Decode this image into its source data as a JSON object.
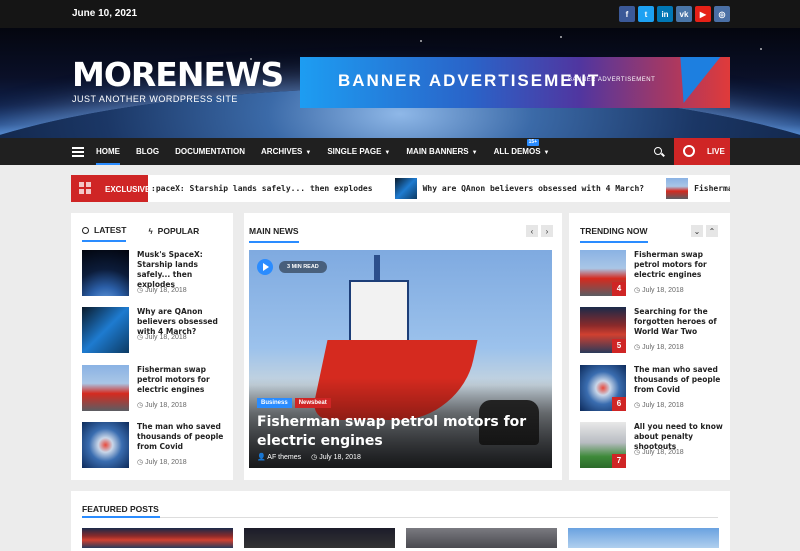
{
  "topbar": {
    "date": "June 10, 2021",
    "socials": [
      {
        "name": "facebook-icon",
        "glyph": "f",
        "color": "#3b5998"
      },
      {
        "name": "twitter-icon",
        "glyph": "t",
        "color": "#1da1f2"
      },
      {
        "name": "linkedin-icon",
        "glyph": "in",
        "color": "#0077b5"
      },
      {
        "name": "vk-icon",
        "glyph": "vk",
        "color": "#4a76a8"
      },
      {
        "name": "youtube-icon",
        "glyph": "▶",
        "color": "#e62117"
      },
      {
        "name": "instagram-icon",
        "glyph": "◎",
        "color": "#4a6fa5"
      }
    ]
  },
  "header": {
    "site_title": "MORENEWS",
    "tagline": "JUST ANOTHER WORDPRESS SITE",
    "banner_text": "BANNER ADVERTISEMENT",
    "banner_small": "BANNER ADVERTISEMENT"
  },
  "nav": {
    "items": [
      {
        "label": "HOME",
        "active": true,
        "dropdown": false
      },
      {
        "label": "BLOG",
        "active": false,
        "dropdown": false
      },
      {
        "label": "DOCUMENTATION",
        "active": false,
        "dropdown": false
      },
      {
        "label": "ARCHIVES",
        "active": false,
        "dropdown": true
      },
      {
        "label": "SINGLE PAGE",
        "active": false,
        "dropdown": true
      },
      {
        "label": "MAIN BANNERS",
        "active": false,
        "dropdown": true
      },
      {
        "label": "ALL DEMOS",
        "active": false,
        "dropdown": true,
        "badge": "15+"
      }
    ],
    "live_label": "LIVE",
    "accent": "#2a8cff",
    "live_color": "#cf2525"
  },
  "ticker": {
    "label": "EXCLUSIVE",
    "items": [
      {
        "text": ":paceX: Starship lands safely... then explodes",
        "thumb": ""
      },
      {
        "text": "Why are QAnon believers obsessed with 4 March?",
        "thumb": "th-phone"
      },
      {
        "text": "Fisherman swap petrol motors for electric engines",
        "thumb": "th-ship"
      }
    ]
  },
  "left_panel": {
    "tab_latest": "LATEST",
    "tab_popular": "POPULAR",
    "items": [
      {
        "title": "Musk's SpaceX: Starship lands safely... then explodes",
        "date": "July 18, 2018",
        "thumb": "th-space"
      },
      {
        "title": "Why are QAnon believers obsessed with 4 March?",
        "date": "July 18, 2018",
        "thumb": "th-phone"
      },
      {
        "title": "Fisherman swap petrol motors for electric engines",
        "date": "July 18, 2018",
        "thumb": "th-ship"
      },
      {
        "title": "The man who saved thousands of people from Covid",
        "date": "July 18, 2018",
        "thumb": "th-virus"
      }
    ]
  },
  "main_news": {
    "section_title": "MAIN NEWS",
    "read_time": "3 MIN READ",
    "categories": [
      {
        "label": "Business",
        "color": "#2a8cff"
      },
      {
        "label": "Newsbeat",
        "color": "#cf2525"
      }
    ],
    "title": "Fisherman swap petrol motors for electric engines",
    "author": "AF themes",
    "date": "July 18, 2018"
  },
  "trending": {
    "section_title": "TRENDING NOW",
    "items": [
      {
        "num": "4",
        "title": "Fisherman swap petrol motors for electric engines",
        "date": "July 18, 2018",
        "thumb": "th-ship"
      },
      {
        "num": "5",
        "title": "Searching for the forgotten heroes of World War Two",
        "date": "July 18, 2018",
        "thumb": "th-heroes"
      },
      {
        "num": "6",
        "title": "The man who saved thousands of people from Covid",
        "date": "July 18, 2018",
        "thumb": "th-virus"
      },
      {
        "num": "7",
        "title": "All you need to know about penalty shootouts",
        "date": "July 18, 2018",
        "thumb": "th-stadium"
      }
    ]
  },
  "featured": {
    "section_title": "FEATURED POSTS",
    "thumbs": [
      "th-heroes",
      "th-dark",
      "th-grey",
      "th-sky"
    ]
  }
}
